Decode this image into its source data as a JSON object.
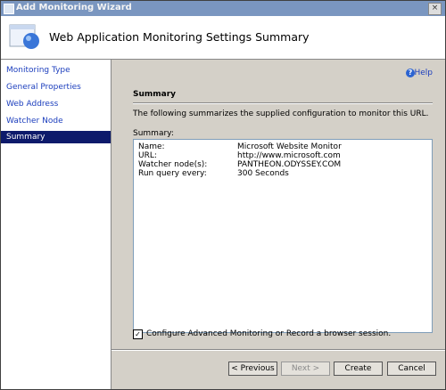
{
  "window": {
    "title": "Add Monitoring Wizard",
    "close_label": "×"
  },
  "header": {
    "title": "Web Application Monitoring Settings Summary"
  },
  "sidebar": {
    "items": [
      {
        "label": "Monitoring Type"
      },
      {
        "label": "General Properties"
      },
      {
        "label": "Web Address"
      },
      {
        "label": "Watcher Node"
      },
      {
        "label": "Summary"
      }
    ],
    "active_index": 4
  },
  "main": {
    "help_label": "Help",
    "section_title": "Summary",
    "description": "The following summarizes the supplied configuration to monitor this URL.",
    "summary_label": "Summary:",
    "summary_rows": [
      {
        "key": "Name:",
        "value": "Microsoft Website Monitor"
      },
      {
        "key": "URL:",
        "value": "http://www.microsoft.com"
      },
      {
        "key": "Watcher node(s):",
        "value": "PANTHEON.ODYSSEY.COM"
      },
      {
        "key": "Run query every:",
        "value": "300 Seconds"
      }
    ],
    "advanced_checkbox": {
      "label": "Configure Advanced Monitoring or Record a browser session.",
      "checked": true
    }
  },
  "footer": {
    "previous_label": "< Previous",
    "next_label": "Next >",
    "create_label": "Create",
    "cancel_label": "Cancel"
  },
  "colors": {
    "title_bar": "#7a96c0",
    "active_item": "#0d1a6b",
    "link": "#1c3ebd"
  }
}
